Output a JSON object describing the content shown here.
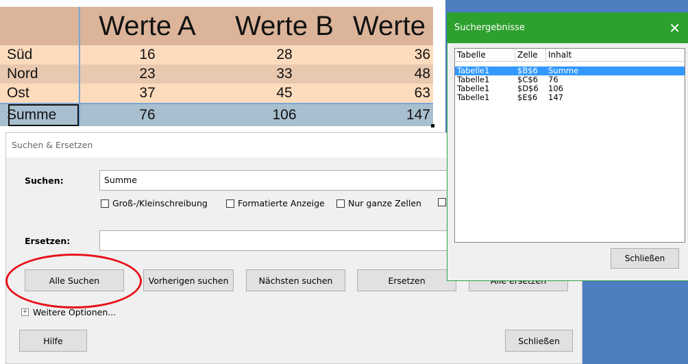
{
  "sheet": {
    "headers": [
      "",
      "Werte A",
      "Werte B",
      "Werte C"
    ],
    "rows": [
      {
        "label": "Süd",
        "a": "16",
        "b": "28",
        "c": "36"
      },
      {
        "label": "Nord",
        "a": "23",
        "b": "33",
        "c": "48"
      },
      {
        "label": "Ost",
        "a": "37",
        "b": "45",
        "c": "63"
      },
      {
        "label": "Summe",
        "a": "76",
        "b": "106",
        "c": "147"
      }
    ]
  },
  "find_dialog": {
    "title": "Suchen & Ersetzen",
    "search_label": "Suchen:",
    "search_value": "Summe",
    "checkboxes": [
      "Groß-/Kleinschreibung",
      "Formatierte Anzeige",
      "Nur ganze Zellen"
    ],
    "replace_label": "Ersetzen:",
    "replace_value": "",
    "buttons": {
      "find_all": "Alle Suchen",
      "find_prev": "Vorherigen suchen",
      "find_next": "Nächsten suchen",
      "replace": "Ersetzen",
      "replace_all": "Alle ersetzen"
    },
    "more_options": "Weitere Optionen...",
    "help": "Hilfe",
    "close": "Schließen"
  },
  "results": {
    "title": "Suchergebnisse",
    "close_glyph": "✕",
    "columns": [
      "Tabelle",
      "Zelle",
      "Inhalt"
    ],
    "rows": [
      {
        "table": "Tabelle1",
        "cell": "$B$6",
        "content": "Summe"
      },
      {
        "table": "Tabelle1",
        "cell": "$C$6",
        "content": "76"
      },
      {
        "table": "Tabelle1",
        "cell": "$D$6",
        "content": "106"
      },
      {
        "table": "Tabelle1",
        "cell": "$E$6",
        "content": "147"
      }
    ],
    "close_button": "Schließen"
  },
  "colors": {
    "header_fill": "#dbb49a",
    "row_fill": "#fddbbd",
    "sum_fill": "#a8bfcf",
    "results_title": "#2ea02e",
    "annotation_circle": "#e8101a",
    "selection": "#3399ff"
  }
}
